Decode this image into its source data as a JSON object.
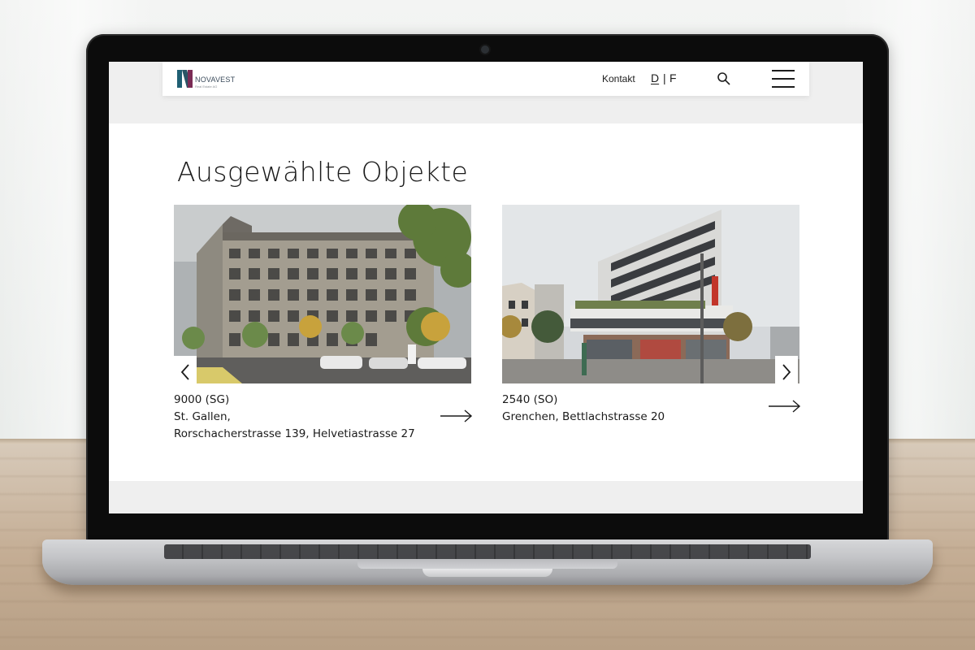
{
  "brand": {
    "name": "NOVAVEST",
    "tagline": "Real Estate AG",
    "colors": {
      "mark_left": "#1f5f73",
      "mark_right": "#7a2b55"
    }
  },
  "header": {
    "nav_contact": "Kontakt",
    "lang_active": "D",
    "lang_separator": "|",
    "lang_other": "F",
    "search_icon": "search-icon",
    "menu_icon": "hamburger-menu-icon"
  },
  "main": {
    "title": "Ausgewählte Objekte",
    "objects": [
      {
        "zip": "9000 (SG)",
        "line2": "St. Gallen,",
        "line3": "Rorschacherstrasse 139, Helvetiastrasse 27",
        "arrow_icon": "arrow-right-icon"
      },
      {
        "zip": "2540 (SO)",
        "line2": "Grenchen, Bettlachstrasse 20",
        "arrow_icon": "arrow-right-icon"
      }
    ],
    "slider_prev_icon": "chevron-left-icon",
    "slider_next_icon": "chevron-right-icon"
  }
}
